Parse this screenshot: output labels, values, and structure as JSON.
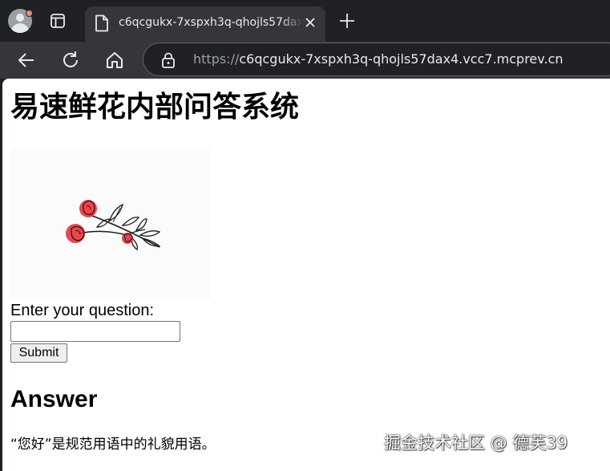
{
  "browser": {
    "tab": {
      "title": "c6qcgukx-7xspxh3q-qhojls57dax4"
    },
    "omnibox": {
      "url_scheme": "https://",
      "url_host": "c6qcgukx-7xspxh3q-qhojls57dax4.vcc7.mcprev.cn"
    },
    "icons": {
      "profile": "profile-avatar-icon",
      "tab_actions": "tab-actions-icon",
      "page": "document-icon",
      "close": "close-icon",
      "new_tab": "plus-icon",
      "back": "back-arrow-icon",
      "reload": "reload-icon",
      "home": "home-icon",
      "site_info": "lock-icon"
    }
  },
  "page": {
    "title": "易速鲜花内部问答系统",
    "image": {
      "subject": "flower-illustration-icon",
      "accent_color": "#e8363f"
    },
    "form": {
      "question_label": "Enter your question:",
      "question_value": "",
      "submit_label": "Submit"
    },
    "answer": {
      "heading": "Answer",
      "text": "“您好”是规范用语中的礼貌用语。"
    }
  },
  "watermark": "掘金技术社区 @ 德芙39"
}
